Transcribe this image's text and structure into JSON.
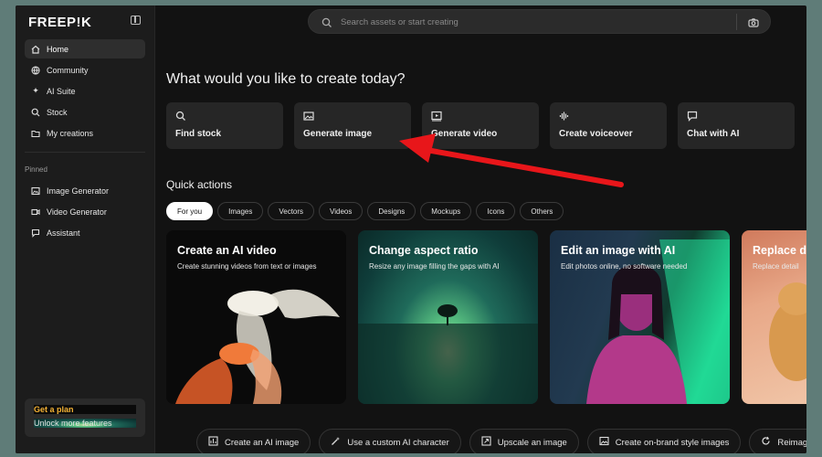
{
  "app": {
    "logo": "FREEP!K"
  },
  "search": {
    "placeholder": "Search assets or start creating"
  },
  "sidebar": {
    "nav": [
      {
        "label": "Home"
      },
      {
        "label": "Community"
      },
      {
        "label": "AI Suite"
      },
      {
        "label": "Stock"
      },
      {
        "label": "My creations"
      }
    ],
    "pinned_label": "Pinned",
    "pinned": [
      {
        "label": "Image Generator"
      },
      {
        "label": "Video Generator"
      },
      {
        "label": "Assistant"
      }
    ],
    "plan": {
      "title": "Get a plan",
      "subtitle": "Unlock more features"
    }
  },
  "main": {
    "headline": "What would you like to create today?",
    "cards": [
      {
        "label": "Find stock"
      },
      {
        "label": "Generate image"
      },
      {
        "label": "Generate video"
      },
      {
        "label": "Create voiceover"
      },
      {
        "label": "Chat with AI"
      }
    ],
    "quick_actions": "Quick actions",
    "chips": [
      "For you",
      "Images",
      "Vectors",
      "Videos",
      "Designs",
      "Mockups",
      "Icons",
      "Others"
    ],
    "tiles": [
      {
        "title": "Create an AI video",
        "subtitle": "Create stunning videos from text or images"
      },
      {
        "title": "Change aspect ratio",
        "subtitle": "Resize any image filling the gaps with AI"
      },
      {
        "title": "Edit an image with AI",
        "subtitle": "Edit photos online, no software needed"
      },
      {
        "title": "Replace d",
        "subtitle": "Replace detail"
      }
    ],
    "bottom_actions": [
      {
        "label": "Create an AI image"
      },
      {
        "label": "Use a custom AI character"
      },
      {
        "label": "Upscale an image"
      },
      {
        "label": "Create on-brand style images"
      },
      {
        "label": "Reimagine"
      }
    ]
  },
  "colors": {
    "accent_plan": "#f5b335",
    "annotation_arrow": "#e8161a"
  }
}
